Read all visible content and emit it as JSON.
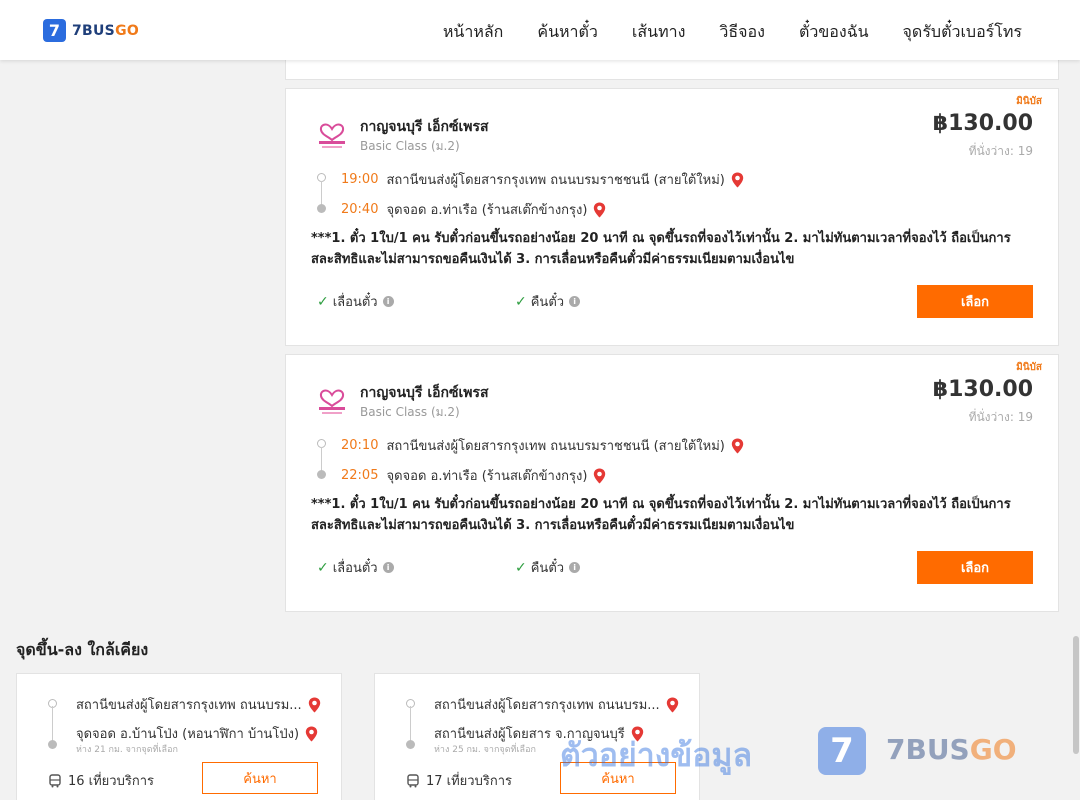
{
  "header": {
    "logo_mark": "7",
    "logo_text_main": "7BUS",
    "logo_text_accent": "GO",
    "nav": [
      "หน้าหลัก",
      "ค้นหาตั๋ว",
      "เส้นทาง",
      "วิธีจอง",
      "ตั๋วของฉัน",
      "จุดรับตั๋วเบอร์โทร"
    ]
  },
  "trips": [
    {
      "badge": "มินิบัส",
      "operator": "กาญจนบุรี เอ็กซ์เพรส",
      "class": "Basic Class (ม.2)",
      "price": "฿130.00",
      "seats": "ที่นั่งว่าง: 19",
      "depart_time": "19:00",
      "depart_place": "สถานีขนส่งผู้โดยสารกรุงเทพ ถนนบรมราชชนนี (สายใต้ใหม่)",
      "arrive_time": "20:40",
      "arrive_place": "จุดจอด อ.ท่าเรือ (ร้านสเต๊กข้างกรุง)",
      "note": "***1. ตั๋ว 1ใบ/1 คน รับตั๋วก่อนขึ้นรถอย่างน้อย 20 นาที ณ จุดขึ้นรถที่จองไว้เท่านั้น 2. มาไม่ทันตามเวลาที่จองไว้ ถือเป็นการสละสิทธิและไม่สามารถขอคืนเงินได้ 3. การเลื่อนหรือคืนตั๋วมีค่าธรรมเนียมตามเงื่อนไข",
      "reschedule": "เลื่อนตั๋ว",
      "refund": "คืนตั๋ว",
      "select": "เลือก"
    },
    {
      "badge": "มินิบัส",
      "operator": "กาญจนบุรี เอ็กซ์เพรส",
      "class": "Basic Class (ม.2)",
      "price": "฿130.00",
      "seats": "ที่นั่งว่าง: 19",
      "depart_time": "20:10",
      "depart_place": "สถานีขนส่งผู้โดยสารกรุงเทพ ถนนบรมราชชนนี (สายใต้ใหม่)",
      "arrive_time": "22:05",
      "arrive_place": "จุดจอด อ.ท่าเรือ (ร้านสเต๊กข้างกรุง)",
      "note": "***1. ตั๋ว 1ใบ/1 คน รับตั๋วก่อนขึ้นรถอย่างน้อย 20 นาที ณ จุดขึ้นรถที่จองไว้เท่านั้น 2. มาไม่ทันตามเวลาที่จองไว้ ถือเป็นการสละสิทธิและไม่สามารถขอคืนเงินได้ 3. การเลื่อนหรือคืนตั๋วมีค่าธรรมเนียมตามเงื่อนไข",
      "reschedule": "เลื่อนตั๋ว",
      "refund": "คืนตั๋ว",
      "select": "เลือก"
    }
  ],
  "nearby": {
    "title": "จุดขึ้น-ลง ใกล้เคียง",
    "cards": [
      {
        "from": "สถานีขนส่งผู้โดยสารกรุงเทพ ถนนบรม...",
        "to": "จุดจอด อ.บ้านโป่ง (หอนาฬิกา บ้านโป่ง)",
        "distance": "ห่าง 21 กม. จากจุดที่เลือก",
        "trips": "16 เที่ยวบริการ",
        "button": "ค้นหา"
      },
      {
        "from": "สถานีขนส่งผู้โดยสารกรุงเทพ ถนนบรม...",
        "to": "สถานีขนส่งผู้โดยสาร จ.กาญจนบุรี",
        "distance": "ห่าง 25 กม. จากจุดที่เลือก",
        "trips": "17 เที่ยวบริการ",
        "button": "ค้นหา"
      }
    ]
  },
  "watermark": {
    "text": "ตัวอย่างข้อมูล",
    "mark": "7",
    "brand_main": "7BUS",
    "brand_accent": "GO"
  },
  "colors": {
    "accent": "#ff6b00",
    "brand_blue": "#2b6cde",
    "check_green": "#2e9e40"
  }
}
